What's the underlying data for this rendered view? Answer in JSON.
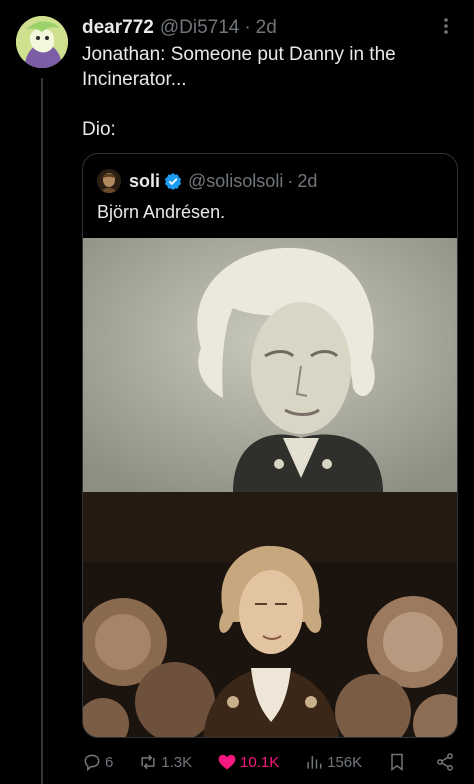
{
  "post": {
    "author_name": "dear772",
    "handle": "@Di5714",
    "separator": "·",
    "time": "2d",
    "text": "Jonathan: Someone put Danny in the Incinerator...\n\nDio:"
  },
  "quote": {
    "author_name": "soli",
    "handle": "@solisolsoli",
    "separator": "·",
    "time": "2d",
    "text": "Björn Andrésen.",
    "verified_color": "#1d9bf0"
  },
  "actions": {
    "replies": "6",
    "reposts": "1.3K",
    "likes": "10.1K",
    "views": "156K",
    "like_color": "#f91880"
  },
  "icons": [
    "more-icon",
    "verified-icon",
    "reply-icon",
    "repost-icon",
    "like-icon",
    "views-icon",
    "bookmark-icon",
    "share-icon"
  ]
}
